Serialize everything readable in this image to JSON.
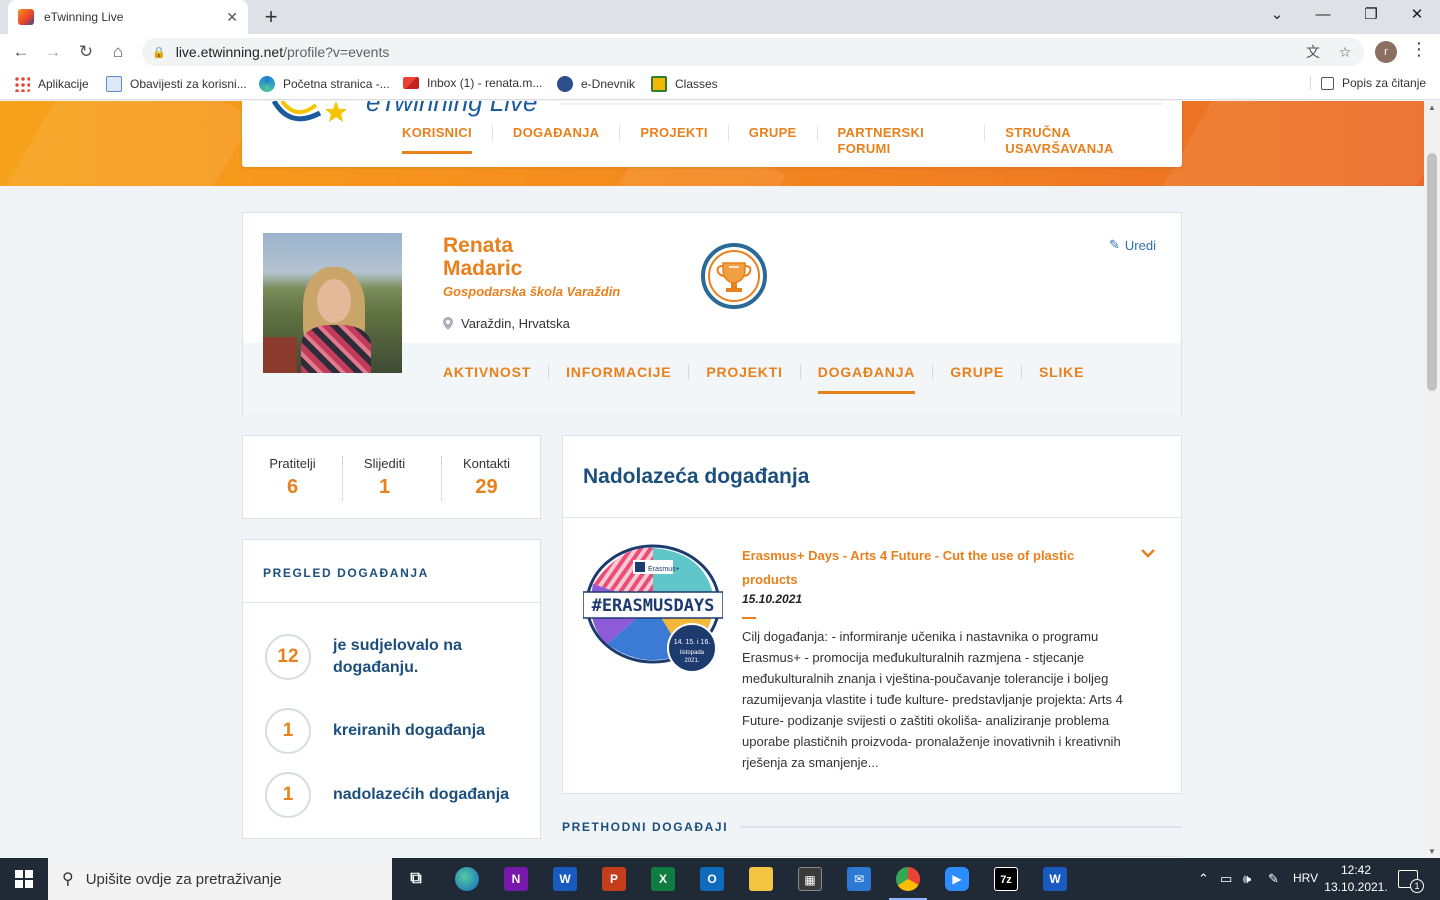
{
  "browser": {
    "tab_title": "eTwinning Live",
    "url_host": "live.etwinning.net",
    "url_path": "/profile?v=events",
    "profile_initial": "r",
    "bookmarks": [
      {
        "label": "Aplikacije",
        "icon": "apps-grid-icon"
      },
      {
        "label": "Obavijesti za korisni...",
        "icon": "notes-icon"
      },
      {
        "label": "Početna stranica -...",
        "icon": "edge-icon"
      },
      {
        "label": "Inbox (1) - renata.m...",
        "icon": "gmail-icon"
      },
      {
        "label": "e-Dnevnik",
        "icon": "ednevnik-icon"
      },
      {
        "label": "Classes",
        "icon": "classes-icon"
      }
    ],
    "reading_list": "Popis za čitanje"
  },
  "site": {
    "logo_text": "eTwinning Live",
    "nav": [
      "KORISNICI",
      "DOGAĐANJA",
      "PROJEKTI",
      "GRUPE",
      "PARTNERSKI FORUMI",
      "STRUČNA USAVRŠAVANJA"
    ],
    "nav_active": "KORISNICI",
    "accent_color": "#e8801c",
    "heading_color": "#1c4f7c"
  },
  "profile": {
    "first_name": "Renata",
    "last_name": "Madaric",
    "school": "Gospodarska škola Varaždin",
    "location": "Varaždin, Hrvatska",
    "edit_label": "Uredi",
    "tabs": [
      "AKTIVNOST",
      "INFORMACIJE",
      "PROJEKTI",
      "DOGAĐANJA",
      "GRUPE",
      "SLIKE"
    ],
    "tab_active": "DOGAĐANJA"
  },
  "stats": [
    {
      "label": "Pratitelji",
      "value": "6"
    },
    {
      "label": "Slijediti",
      "value": "1"
    },
    {
      "label": "Kontakti",
      "value": "29"
    }
  ],
  "overview": {
    "title": "PREGLED DOGAĐANJA",
    "rows": [
      {
        "count": "12",
        "text": "je sudjelovalo na događanju."
      },
      {
        "count": "1",
        "text": "kreiranih događanja"
      },
      {
        "count": "1",
        "text": "nadolazećih događanja"
      }
    ]
  },
  "upcoming": {
    "title": "Nadolazeća događanja",
    "event": {
      "image_text": "#ERASMUSDAYS",
      "image_brand": "Erasmus+",
      "image_dates": "14. 15. i 16.",
      "image_month": "listopada",
      "image_year": "2021.",
      "title": "Erasmus+ Days - Arts 4 Future - Cut the use of plastic products",
      "date": "15.10.2021",
      "description": "Cilj događanja: - informiranje učenika i nastavnika o programu Erasmus+ - promocija međukulturalnih razmjena - stjecanje međukulturalnih znanja i vještina-poučavanje tolerancije i boljeg razumijevanja vlastite i tuđe kulture- predstavljanje projekta: Arts 4 Future- podizanje svijesti o zaštiti okoliša- analiziranje problema uporabe plastičnih proizvoda- pronalaženje inovativnih i kreativnih rješenja za smanjenje..."
    }
  },
  "previous": {
    "title": "PRETHODNI DOGAĐAJI"
  },
  "taskbar": {
    "search_placeholder": "Upišite ovdje za pretraživanje",
    "language": "HRV",
    "time": "12:42",
    "date": "13.10.2021.",
    "notification_count": "1"
  }
}
